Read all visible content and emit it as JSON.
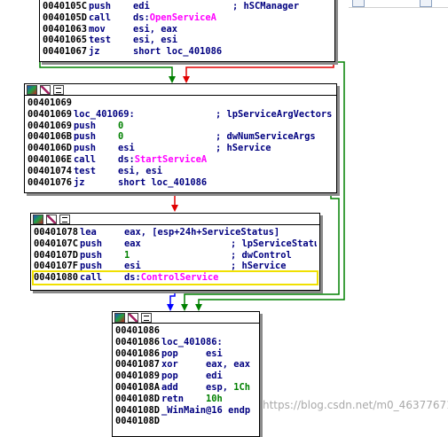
{
  "blocks": [
    {
      "id": "block-1",
      "lines": [
        {
          "addr": "0040105C",
          "mn": "push",
          "op": "edi",
          "cmt": "; hSCManager"
        },
        {
          "addr": "0040105D",
          "mn": "call",
          "op_prefix": "ds:",
          "fn": "OpenServiceA"
        },
        {
          "addr": "00401063",
          "mn": "mov",
          "op": "esi, eax"
        },
        {
          "addr": "00401065",
          "mn": "test",
          "op": "esi, esi"
        },
        {
          "addr": "00401067",
          "mn": "jz",
          "op": "short loc_401086"
        }
      ]
    },
    {
      "id": "block-2",
      "lines": [
        {
          "addr": "00401069"
        },
        {
          "addr": "00401069",
          "label": "loc_401069:",
          "cmt": "; lpServiceArgVectors"
        },
        {
          "addr": "00401069",
          "mn": "push",
          "num": "0"
        },
        {
          "addr": "0040106B",
          "mn": "push",
          "num": "0",
          "cmt": "; dwNumServiceArgs"
        },
        {
          "addr": "0040106D",
          "mn": "push",
          "op": "esi",
          "cmt": "; hService"
        },
        {
          "addr": "0040106E",
          "mn": "call",
          "op_prefix": "ds:",
          "fn": "StartServiceA"
        },
        {
          "addr": "00401074",
          "mn": "test",
          "op": "esi, esi"
        },
        {
          "addr": "00401076",
          "mn": "jz",
          "op": "short loc_401086"
        }
      ]
    },
    {
      "id": "block-3",
      "lines": [
        {
          "addr": "00401078",
          "mn": "lea",
          "op": "eax, [esp+24h+ServiceStatus]"
        },
        {
          "addr": "0040107C",
          "mn": "push",
          "op": "eax",
          "cmt": "; lpServiceStatus"
        },
        {
          "addr": "0040107D",
          "mn": "push",
          "num": "1",
          "cmt": "; dwControl"
        },
        {
          "addr": "0040107F",
          "mn": "push",
          "op": "esi",
          "cmt": "; hService"
        },
        {
          "addr": "00401080",
          "mn": "call",
          "op_prefix": "ds:",
          "fn": "ControlService",
          "highlight": true
        }
      ]
    },
    {
      "id": "block-4",
      "lines": [
        {
          "addr": "00401086"
        },
        {
          "addr": "00401086",
          "label": "loc_401086:"
        },
        {
          "addr": "00401086",
          "mn": "pop",
          "op": "esi"
        },
        {
          "addr": "00401087",
          "mn": "xor",
          "op": "eax, eax"
        },
        {
          "addr": "00401089",
          "mn": "pop",
          "op": "edi"
        },
        {
          "addr": "0040108A",
          "mn": "add",
          "op": "esp, ",
          "num": "1Ch"
        },
        {
          "addr": "0040108D",
          "mn": "retn",
          "num": "10h"
        },
        {
          "addr": "0040108D",
          "label": "_WinMain@16 endp"
        },
        {
          "addr": "0040108D"
        }
      ]
    }
  ],
  "watermark": "https://blog.csdn.net/m0_46377671",
  "colors": {
    "edge_true": "#008000",
    "edge_false": "#e00000",
    "edge_flow": "#0000ff",
    "highlight": "#f0e000"
  }
}
